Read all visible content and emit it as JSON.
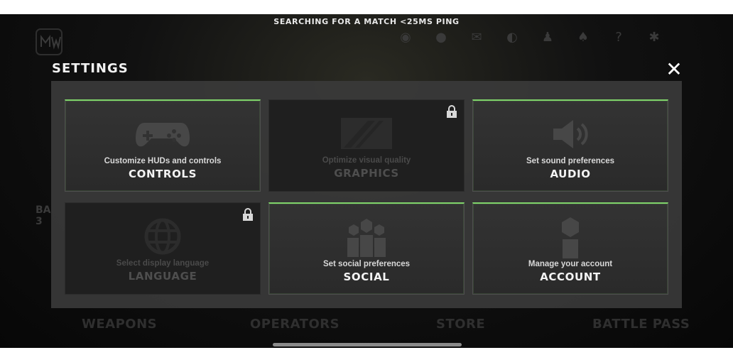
{
  "status": {
    "text": "SEARCHING FOR A MATCH <25MS PING"
  },
  "background": {
    "nav": [
      "WEAPONS",
      "OPERATORS",
      "STORE",
      "BATTLE PASS"
    ]
  },
  "header": {
    "title": "SETTINGS",
    "close_label": "✕"
  },
  "colors": {
    "accent": "#7fd36a",
    "panel": "#3a3a3a",
    "card": "#2b2b2b"
  },
  "cards": [
    {
      "subtitle": "Customize HUDs and controls",
      "title": "CONTROLS",
      "icon": "gamepad-icon",
      "locked": false
    },
    {
      "subtitle": "Optimize visual quality",
      "title": "GRAPHICS",
      "icon": "graphics-icon",
      "locked": true
    },
    {
      "subtitle": "Set sound preferences",
      "title": "AUDIO",
      "icon": "speaker-icon",
      "locked": false
    },
    {
      "subtitle": "Select display language",
      "title": "LANGUAGE",
      "icon": "globe-icon",
      "locked": true
    },
    {
      "subtitle": "Set social preferences",
      "title": "SOCIAL",
      "icon": "group-icon",
      "locked": false
    },
    {
      "subtitle": "Manage your account",
      "title": "ACCOUNT",
      "icon": "user-icon",
      "locked": false
    }
  ]
}
